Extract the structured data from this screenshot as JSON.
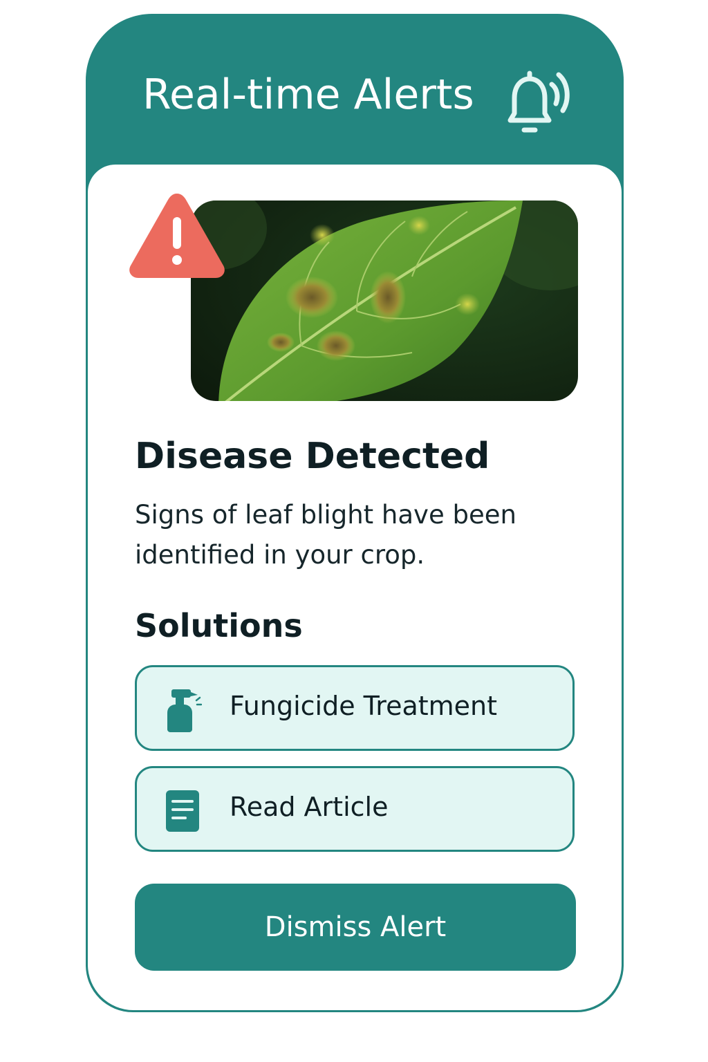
{
  "header": {
    "title": "Real-time Alerts",
    "icon": "bell-ringing-icon"
  },
  "alert": {
    "warning_icon": "warning-triangle-icon",
    "image_subject": "leaf-with-spots",
    "title": "Disease Detected",
    "description": "Signs of leaf blight have been identified in your crop."
  },
  "solutions": {
    "heading": "Solutions",
    "items": [
      {
        "label": "Fungicide Treatment",
        "icon": "spray-bottle-icon"
      },
      {
        "label": "Read Article",
        "icon": "document-icon"
      }
    ]
  },
  "actions": {
    "dismiss_label": "Dismiss Alert"
  },
  "colors": {
    "primary": "#238680",
    "solution_bg": "#e2f6f3",
    "warning": "#ec6b5e",
    "text": "#0f1f24"
  }
}
